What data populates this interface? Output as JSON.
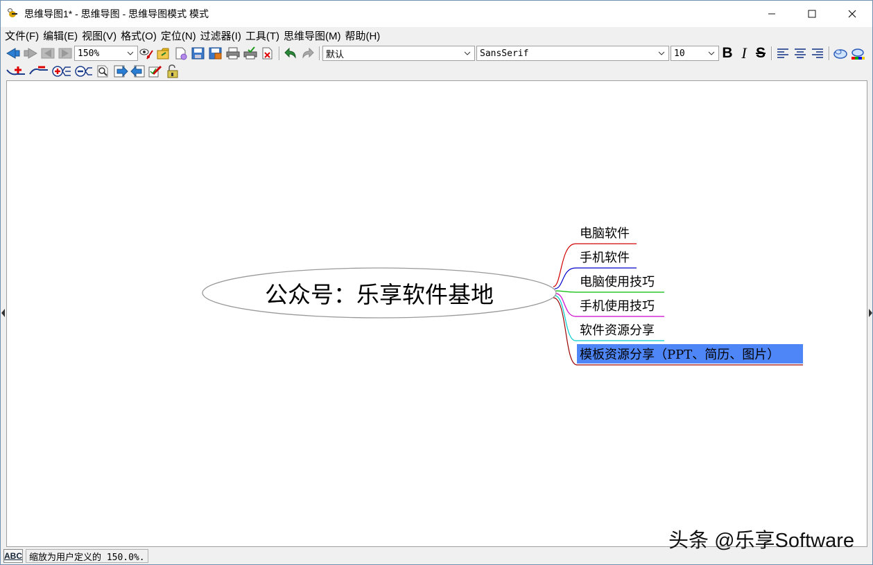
{
  "window": {
    "title": "思维导图1* - 思维导图 - 思维导图模式 模式",
    "minimize": "—",
    "maximize": "☐",
    "close": "✕"
  },
  "menu": [
    {
      "label": "文件(F)"
    },
    {
      "label": "编辑(E)"
    },
    {
      "label": "视图(V)"
    },
    {
      "label": "格式(O)"
    },
    {
      "label": "定位(N)"
    },
    {
      "label": "过滤器(I)"
    },
    {
      "label": "工具(T)"
    },
    {
      "label": "思维导图(M)"
    },
    {
      "label": "帮助(H)"
    }
  ],
  "toolbar": {
    "zoom_value": "150%",
    "style_value": "默认",
    "font_value": "SansSerif",
    "size_value": "10",
    "bold": "B",
    "italic": "I",
    "strike": "S"
  },
  "mindmap": {
    "root": "公众号：乐享软件基地",
    "children": [
      {
        "label": "电脑软件",
        "color": "#d00000",
        "selected": false
      },
      {
        "label": "手机软件",
        "color": "#0000cc",
        "selected": false
      },
      {
        "label": "电脑使用技巧",
        "color": "#00bb00",
        "selected": false
      },
      {
        "label": "手机使用技巧",
        "color": "#cc00cc",
        "selected": false
      },
      {
        "label": "软件资源分享",
        "color": "#00cccc",
        "selected": false
      },
      {
        "label": "模板资源分享（PPT、简历、图片）",
        "color": "#990000",
        "selected": true
      }
    ],
    "selection_color": "#4f86f7"
  },
  "status": {
    "spell_label": "ABC",
    "message": "缩放为用户定义的 150.0%."
  },
  "watermark": "头条 @乐享Software"
}
